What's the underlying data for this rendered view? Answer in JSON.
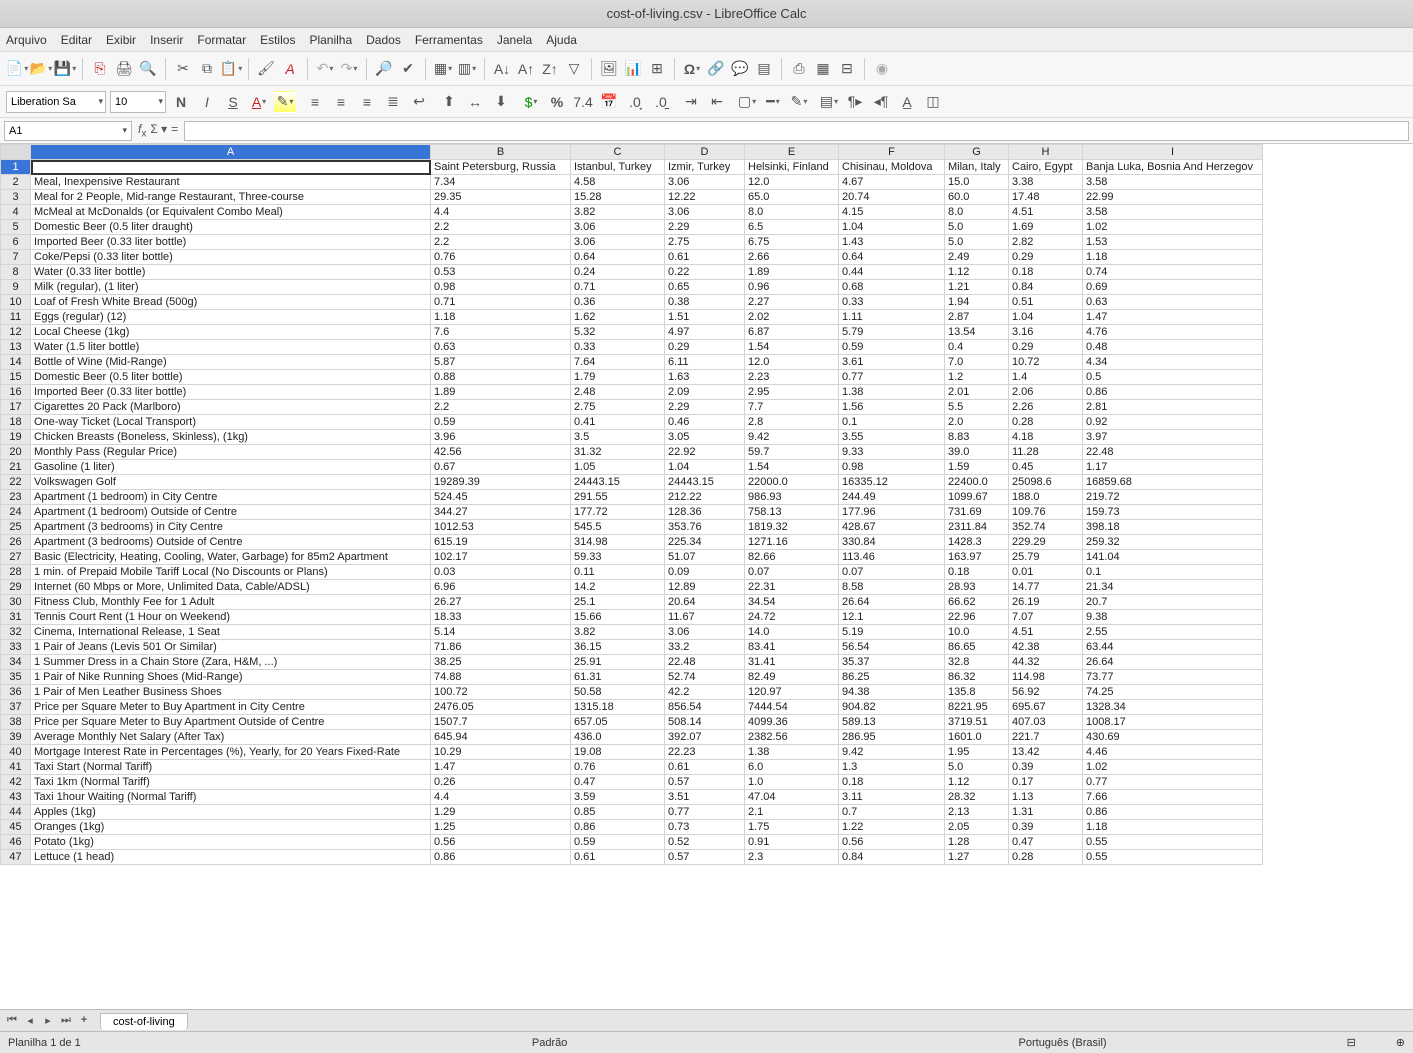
{
  "window": {
    "title": "cost-of-living.csv - LibreOffice Calc"
  },
  "menu": [
    "Arquivo",
    "Editar",
    "Exibir",
    "Inserir",
    "Formatar",
    "Estilos",
    "Planilha",
    "Dados",
    "Ferramentas",
    "Janela",
    "Ajuda"
  ],
  "font": {
    "name": "Liberation Sa",
    "size": "10"
  },
  "namebox": "A1",
  "sheet_tab": "cost-of-living",
  "status": {
    "sheet": "Planilha 1 de 1",
    "style": "Padrão",
    "lang": "Português (Brasil)"
  },
  "columns": [
    "A",
    "B",
    "C",
    "D",
    "E",
    "F",
    "G",
    "H",
    "I"
  ],
  "headers_row": [
    "",
    "Saint Petersburg, Russia",
    "Istanbul, Turkey",
    "Izmir, Turkey",
    "Helsinki, Finland",
    "Chisinau, Moldova",
    "Milan, Italy",
    "Cairo, Egypt",
    "Banja Luka, Bosnia And Herzegov"
  ],
  "rows": [
    [
      "Meal, Inexpensive Restaurant",
      "7.34",
      "4.58",
      "3.06",
      "12.0",
      "4.67",
      "15.0",
      "3.38",
      "3.58"
    ],
    [
      "Meal for 2 People, Mid-range Restaurant, Three-course",
      "29.35",
      "15.28",
      "12.22",
      "65.0",
      "20.74",
      "60.0",
      "17.48",
      "22.99"
    ],
    [
      "McMeal at McDonalds (or Equivalent Combo Meal)",
      "4.4",
      "3.82",
      "3.06",
      "8.0",
      "4.15",
      "8.0",
      "4.51",
      "3.58"
    ],
    [
      "Domestic Beer (0.5 liter draught)",
      "2.2",
      "3.06",
      "2.29",
      "6.5",
      "1.04",
      "5.0",
      "1.69",
      "1.02"
    ],
    [
      "Imported Beer (0.33 liter bottle)",
      "2.2",
      "3.06",
      "2.75",
      "6.75",
      "1.43",
      "5.0",
      "2.82",
      "1.53"
    ],
    [
      "Coke/Pepsi (0.33 liter bottle)",
      "0.76",
      "0.64",
      "0.61",
      "2.66",
      "0.64",
      "2.49",
      "0.29",
      "1.18"
    ],
    [
      "Water (0.33 liter bottle)",
      "0.53",
      "0.24",
      "0.22",
      "1.89",
      "0.44",
      "1.12",
      "0.18",
      "0.74"
    ],
    [
      "Milk (regular), (1 liter)",
      "0.98",
      "0.71",
      "0.65",
      "0.96",
      "0.68",
      "1.21",
      "0.84",
      "0.69"
    ],
    [
      "Loaf of Fresh White Bread (500g)",
      "0.71",
      "0.36",
      "0.38",
      "2.27",
      "0.33",
      "1.94",
      "0.51",
      "0.63"
    ],
    [
      "Eggs (regular) (12)",
      "1.18",
      "1.62",
      "1.51",
      "2.02",
      "1.11",
      "2.87",
      "1.04",
      "1.47"
    ],
    [
      "Local Cheese (1kg)",
      "7.6",
      "5.32",
      "4.97",
      "6.87",
      "5.79",
      "13.54",
      "3.16",
      "4.76"
    ],
    [
      "Water (1.5 liter bottle)",
      "0.63",
      "0.33",
      "0.29",
      "1.54",
      "0.59",
      "0.4",
      "0.29",
      "0.48"
    ],
    [
      "Bottle of Wine (Mid-Range)",
      "5.87",
      "7.64",
      "6.11",
      "12.0",
      "3.61",
      "7.0",
      "10.72",
      "4.34"
    ],
    [
      "Domestic Beer (0.5 liter bottle)",
      "0.88",
      "1.79",
      "1.63",
      "2.23",
      "0.77",
      "1.2",
      "1.4",
      "0.5"
    ],
    [
      "Imported Beer (0.33 liter bottle)",
      "1.89",
      "2.48",
      "2.09",
      "2.95",
      "1.38",
      "2.01",
      "2.06",
      "0.86"
    ],
    [
      "Cigarettes 20 Pack (Marlboro)",
      "2.2",
      "2.75",
      "2.29",
      "7.7",
      "1.56",
      "5.5",
      "2.26",
      "2.81"
    ],
    [
      "One-way Ticket (Local Transport)",
      "0.59",
      "0.41",
      "0.46",
      "2.8",
      "0.1",
      "2.0",
      "0.28",
      "0.92"
    ],
    [
      "Chicken Breasts (Boneless, Skinless), (1kg)",
      "3.96",
      "3.5",
      "3.05",
      "9.42",
      "3.55",
      "8.83",
      "4.18",
      "3.97"
    ],
    [
      "Monthly Pass (Regular Price)",
      "42.56",
      "31.32",
      "22.92",
      "59.7",
      "9.33",
      "39.0",
      "11.28",
      "22.48"
    ],
    [
      "Gasoline (1 liter)",
      "0.67",
      "1.05",
      "1.04",
      "1.54",
      "0.98",
      "1.59",
      "0.45",
      "1.17"
    ],
    [
      "Volkswagen Golf",
      "19289.39",
      "24443.15",
      "24443.15",
      "22000.0",
      "16335.12",
      "22400.0",
      "25098.6",
      "16859.68"
    ],
    [
      "Apartment (1 bedroom) in City Centre",
      "524.45",
      "291.55",
      "212.22",
      "986.93",
      "244.49",
      "1099.67",
      "188.0",
      "219.72"
    ],
    [
      "Apartment (1 bedroom) Outside of Centre",
      "344.27",
      "177.72",
      "128.36",
      "758.13",
      "177.96",
      "731.69",
      "109.76",
      "159.73"
    ],
    [
      "Apartment (3 bedrooms) in City Centre",
      "1012.53",
      "545.5",
      "353.76",
      "1819.32",
      "428.67",
      "2311.84",
      "352.74",
      "398.18"
    ],
    [
      "Apartment (3 bedrooms) Outside of Centre",
      "615.19",
      "314.98",
      "225.34",
      "1271.16",
      "330.84",
      "1428.3",
      "229.29",
      "259.32"
    ],
    [
      "Basic (Electricity, Heating, Cooling, Water, Garbage) for 85m2 Apartment",
      "102.17",
      "59.33",
      "51.07",
      "82.66",
      "113.46",
      "163.97",
      "25.79",
      "141.04"
    ],
    [
      "1 min. of Prepaid Mobile Tariff Local (No Discounts or Plans)",
      "0.03",
      "0.11",
      "0.09",
      "0.07",
      "0.07",
      "0.18",
      "0.01",
      "0.1"
    ],
    [
      "Internet (60 Mbps or More, Unlimited Data, Cable/ADSL)",
      "6.96",
      "14.2",
      "12.89",
      "22.31",
      "8.58",
      "28.93",
      "14.77",
      "21.34"
    ],
    [
      "Fitness Club, Monthly Fee for 1 Adult",
      "26.27",
      "25.1",
      "20.64",
      "34.54",
      "26.64",
      "66.62",
      "26.19",
      "20.7"
    ],
    [
      "Tennis Court Rent (1 Hour on Weekend)",
      "18.33",
      "15.66",
      "11.67",
      "24.72",
      "12.1",
      "22.96",
      "7.07",
      "9.38"
    ],
    [
      "Cinema, International Release, 1 Seat",
      "5.14",
      "3.82",
      "3.06",
      "14.0",
      "5.19",
      "10.0",
      "4.51",
      "2.55"
    ],
    [
      "1 Pair of Jeans (Levis 501 Or Similar)",
      "71.86",
      "36.15",
      "33.2",
      "83.41",
      "56.54",
      "86.65",
      "42.38",
      "63.44"
    ],
    [
      "1 Summer Dress in a Chain Store (Zara, H&M, ...)",
      "38.25",
      "25.91",
      "22.48",
      "31.41",
      "35.37",
      "32.8",
      "44.32",
      "26.64"
    ],
    [
      "1 Pair of Nike Running Shoes (Mid-Range)",
      "74.88",
      "61.31",
      "52.74",
      "82.49",
      "86.25",
      "86.32",
      "114.98",
      "73.77"
    ],
    [
      "1 Pair of Men Leather Business Shoes",
      "100.72",
      "50.58",
      "42.2",
      "120.97",
      "94.38",
      "135.8",
      "56.92",
      "74.25"
    ],
    [
      "Price per Square Meter to Buy Apartment in City Centre",
      "2476.05",
      "1315.18",
      "856.54",
      "7444.54",
      "904.82",
      "8221.95",
      "695.67",
      "1328.34"
    ],
    [
      "Price per Square Meter to Buy Apartment Outside of Centre",
      "1507.7",
      "657.05",
      "508.14",
      "4099.36",
      "589.13",
      "3719.51",
      "407.03",
      "1008.17"
    ],
    [
      "Average Monthly Net Salary (After Tax)",
      "645.94",
      "436.0",
      "392.07",
      "2382.56",
      "286.95",
      "1601.0",
      "221.7",
      "430.69"
    ],
    [
      "Mortgage Interest Rate in Percentages (%), Yearly, for 20 Years Fixed-Rate",
      "10.29",
      "19.08",
      "22.23",
      "1.38",
      "9.42",
      "1.95",
      "13.42",
      "4.46"
    ],
    [
      "Taxi Start (Normal Tariff)",
      "1.47",
      "0.76",
      "0.61",
      "6.0",
      "1.3",
      "5.0",
      "0.39",
      "1.02"
    ],
    [
      "Taxi 1km (Normal Tariff)",
      "0.26",
      "0.47",
      "0.57",
      "1.0",
      "0.18",
      "1.12",
      "0.17",
      "0.77"
    ],
    [
      "Taxi 1hour Waiting (Normal Tariff)",
      "4.4",
      "3.59",
      "3.51",
      "47.04",
      "3.11",
      "28.32",
      "1.13",
      "7.66"
    ],
    [
      "Apples (1kg)",
      "1.29",
      "0.85",
      "0.77",
      "2.1",
      "0.7",
      "2.13",
      "1.31",
      "0.86"
    ],
    [
      "Oranges (1kg)",
      "1.25",
      "0.86",
      "0.73",
      "1.75",
      "1.22",
      "2.05",
      "0.39",
      "1.18"
    ],
    [
      "Potato (1kg)",
      "0.56",
      "0.59",
      "0.52",
      "0.91",
      "0.56",
      "1.28",
      "0.47",
      "0.55"
    ],
    [
      "Lettuce (1 head)",
      "0.86",
      "0.61",
      "0.57",
      "2.3",
      "0.84",
      "1.27",
      "0.28",
      "0.55"
    ]
  ]
}
